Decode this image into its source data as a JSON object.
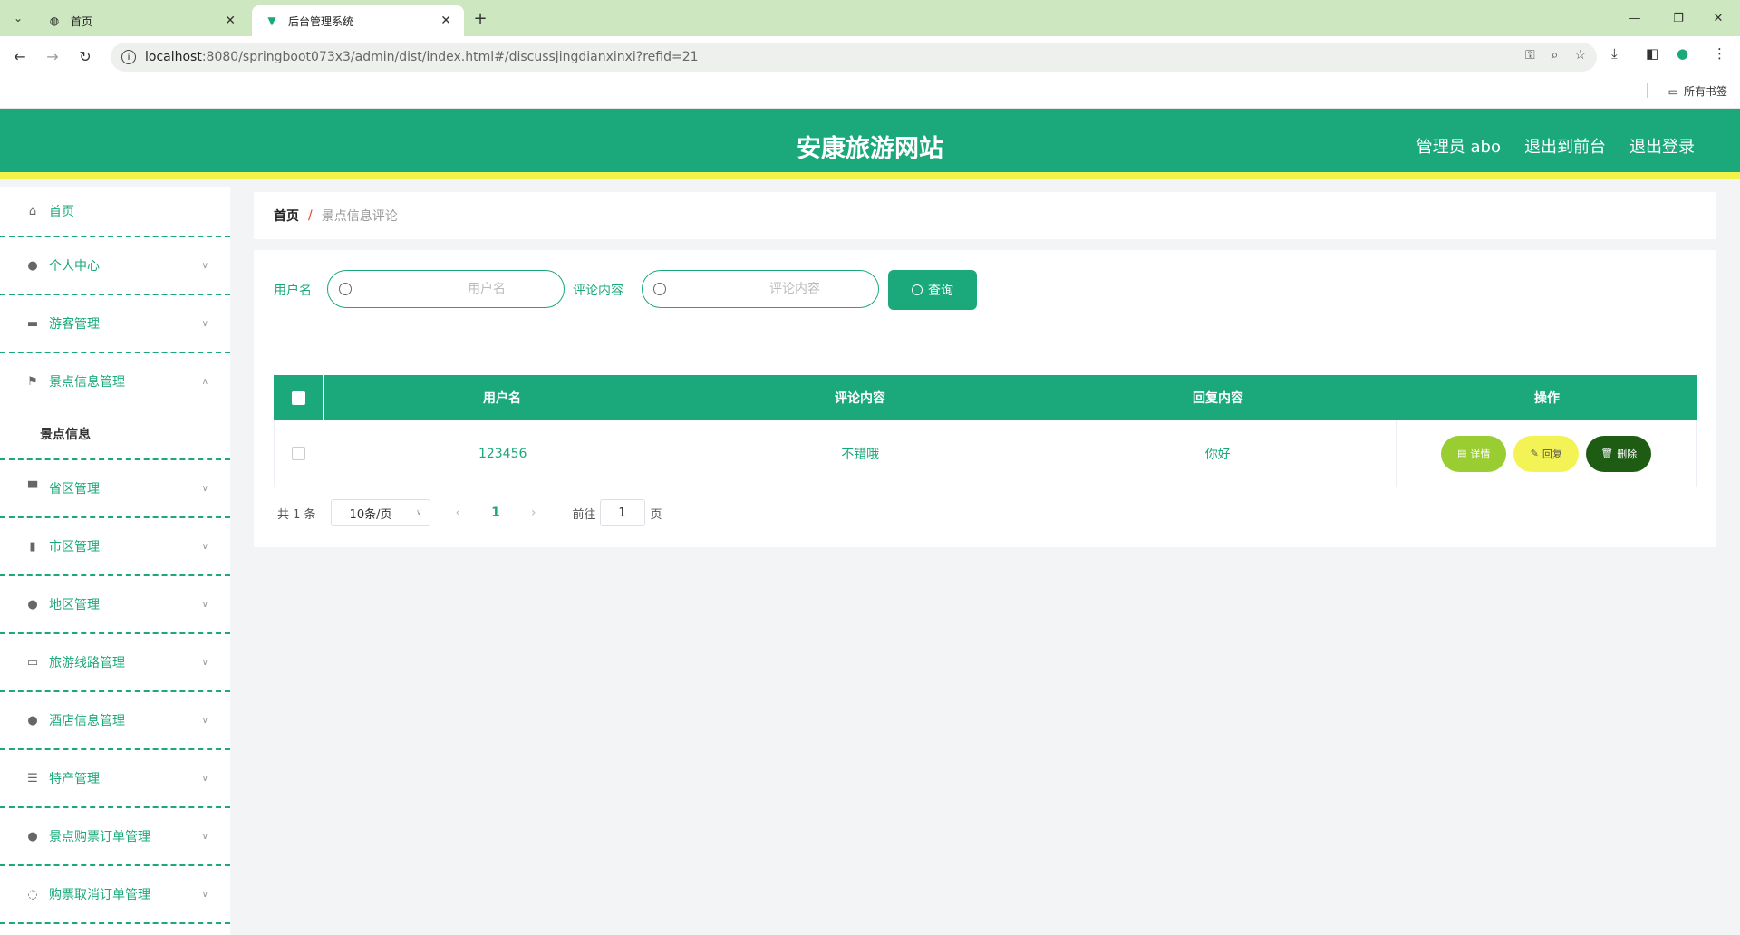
{
  "browser": {
    "tabs": [
      {
        "title": "首页",
        "icon": "globe-icon"
      },
      {
        "title": "后台管理系统",
        "icon": "vue-icon"
      }
    ],
    "url_host": "localhost",
    "url_rest": ":8080/springboot073x3/admin/dist/index.html#/discussjingdianxinxi?refid=21",
    "bookmarks_label": "所有书签"
  },
  "header": {
    "title": "安康旅游网站",
    "links": [
      "管理员 abo",
      "退出到前台",
      "退出登录"
    ]
  },
  "sidebar": {
    "items": [
      {
        "label": "首页",
        "icon": "home-icon"
      },
      {
        "label": "个人中心",
        "icon": "user-icon"
      },
      {
        "label": "游客管理",
        "icon": "ticket-icon"
      },
      {
        "label": "景点信息管理",
        "icon": "flag-icon"
      },
      {
        "label": "省区管理",
        "icon": "sign-icon"
      },
      {
        "label": "市区管理",
        "icon": "chart-icon"
      },
      {
        "label": "地区管理",
        "icon": "user-icon"
      },
      {
        "label": "旅游线路管理",
        "icon": "chat-icon"
      },
      {
        "label": "酒店信息管理",
        "icon": "bulb-icon"
      },
      {
        "label": "特产管理",
        "icon": "sliders-icon"
      },
      {
        "label": "景点购票订单管理",
        "icon": "user-icon"
      },
      {
        "label": "购票取消订单管理",
        "icon": "circle-icon"
      }
    ],
    "sub_items": [
      "景点信息"
    ]
  },
  "breadcrumb": {
    "home": "首页",
    "separator": "/",
    "current": "景点信息评论"
  },
  "search": {
    "username_label": "用户名",
    "username_placeholder": "用户名",
    "content_label": "评论内容",
    "content_placeholder": "评论内容",
    "query_button": "查询"
  },
  "table": {
    "columns": [
      "用户名",
      "评论内容",
      "回复内容",
      "操作"
    ],
    "rows": [
      {
        "username": "123456",
        "content": "不错哦",
        "reply": "你好"
      }
    ],
    "actions": {
      "detail": "详情",
      "reply": "回复",
      "delete": "删除"
    }
  },
  "pagination": {
    "total": "共 1 条",
    "page_size": "10条/页",
    "current_page": "1",
    "goto_label": "前往",
    "goto_value": "1",
    "page_unit": "页"
  },
  "colors": {
    "primary": "#1ba97b",
    "accent_bar": "#f2f34a",
    "detail": "#9acd32",
    "reply": "#f4f355",
    "delete": "#1e5c14"
  }
}
